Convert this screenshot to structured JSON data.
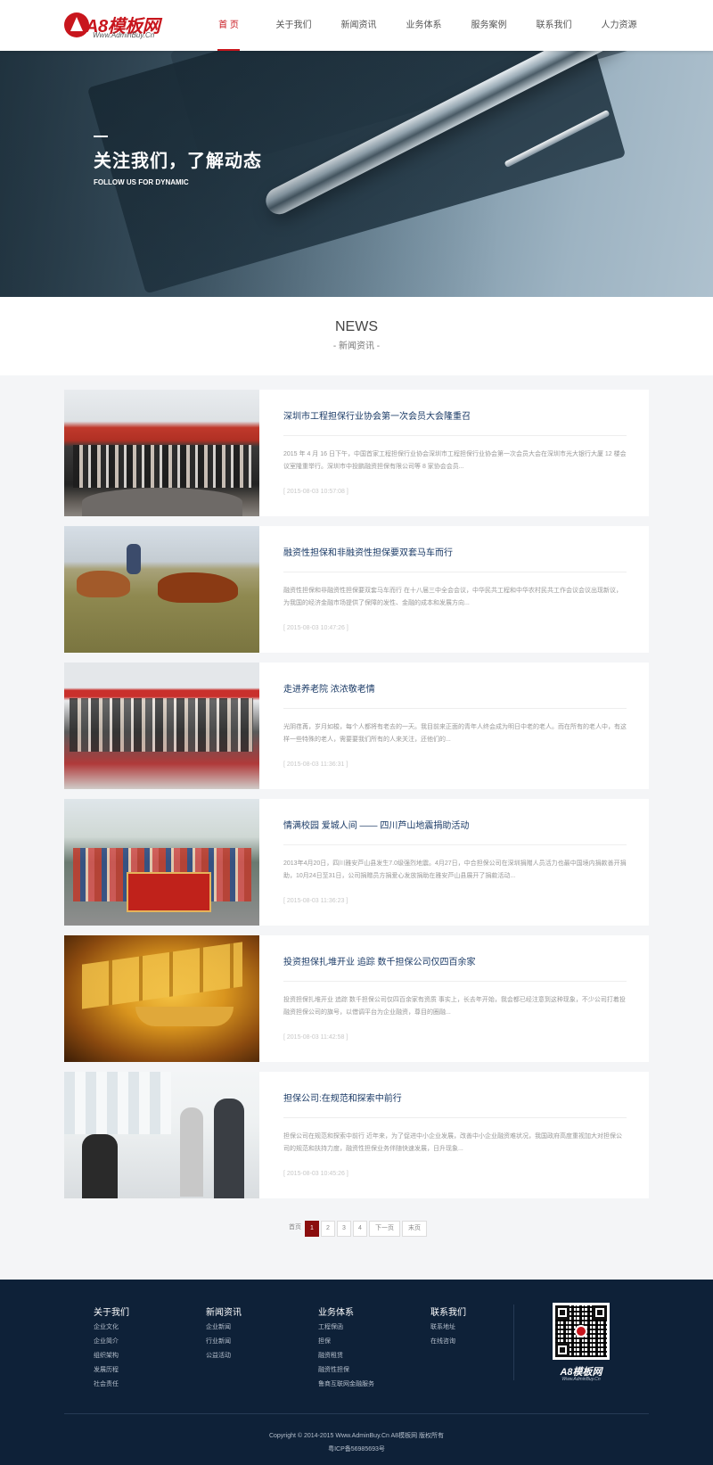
{
  "header": {
    "logo_name": "A8模板网",
    "logo_domain": "Www.AdminBuy.Cn",
    "nav": [
      "首 页",
      "关于我们",
      "新闻资讯",
      "业务体系",
      "服务案例",
      "联系我们",
      "人力资源"
    ]
  },
  "banner": {
    "title": "关注我们，了解动态",
    "subtitle": "FOLLOW US FOR DYNAMIC"
  },
  "section": {
    "title": "NEWS",
    "subtitle": "- 新闻资讯 -"
  },
  "news": [
    {
      "title": "深圳市工程担保行业协会第一次会员大会隆重召",
      "excerpt": "2015 年 4 月 16 日下午，中国首家工程担保行业协会深圳市工程担保行业协会第一次会员大会在深圳市光大银行大厦 12 楼会议室隆重举行。深圳市中投鹏融资担保有限公司等 8 家协会会员...",
      "date": "[ 2015-08-03 10:57:08 ]"
    },
    {
      "title": "融资性担保和非融资性担保要双套马车而行",
      "excerpt": "融资性担保和非融资性担保要双套马车而行 在十八届三中全会会议，中华民共工程和中华农村民共工作会议会议出现新议，为我国的经济金融市场提供了保障的发性、金融的成本和发展方向...",
      "date": "[ 2015-08-03 10:47:26 ]"
    },
    {
      "title": "走进养老院 浓浓敬老情",
      "excerpt": "光阴荏苒，岁月如梭，每个人都将有老去的一天。我目前来正面的青年人终会成为明日中老的老人。而在所有的老人中，有这样一些特殊的老人，需要要我们所有的人来关注，还他们的...",
      "date": "[ 2015-08-03 11:36:31 ]"
    },
    {
      "title": "情满校园 爱城人间 —— 四川芦山地震捐助活动",
      "excerpt": "2013年4月20日，四川雅安芦山县发生7.0级强烈地震。4月27日，中合担保公司在深圳捐赠人员活力也最中国境内捐款善开捐助，10月24日至31日，公司捐赠员方捐爱心发放捐助在雅安芦山县展开了捐款活动...",
      "date": "[ 2015-08-03 11:36:23 ]"
    },
    {
      "title": "投资担保扎堆开业 追踪 数千担保公司仅四百余家",
      "excerpt": "投资担保扎堆开业 追踪 数千担保公司仅四百余家有资质 事实上，长去年开始，我会都已经注意到这种现象，不少公司打着投融资担保公司的旗号，以借调平台为企业融资，尊目的圈融...",
      "date": "[ 2015-08-03 11:42:58 ]"
    },
    {
      "title": "担保公司:在规范和探索中前行",
      "excerpt": "担保公司在规范和探索中前行 近年来，为了促进中小企业发展，改善中小企业融资难状况，我国政府高度重视加大对担保公司的规范和扶持力度，融资性担保业务伴随快速发展，日升现象...",
      "date": "[ 2015-08-03 10:45:26 ]"
    }
  ],
  "pagination": {
    "first": "首页",
    "pages": [
      "1",
      "2",
      "3",
      "4"
    ],
    "next": "下一页",
    "last": "末页"
  },
  "footer": {
    "columns": [
      {
        "title": "关于我们",
        "links": [
          "企业文化",
          "企业简介",
          "组织架构",
          "发展历程",
          "社会责任"
        ]
      },
      {
        "title": "新闻资讯",
        "links": [
          "企业新闻",
          "行业新闻",
          "公益活动"
        ]
      },
      {
        "title": "业务体系",
        "links": [
          "工程保函",
          "担保",
          "融资租赁",
          "融资性担保",
          "鲁商互联网金融服务"
        ]
      },
      {
        "title": "联系我们",
        "links": [
          "联系地址",
          "在线咨询"
        ]
      }
    ],
    "qr_caption": "A8模板网",
    "qr_caption_sub": "Www.AdminBuy.Cn",
    "copyright": "Copyright © 2014-2015 Www.AdminBuy.Cn A8模板网 版权所有",
    "icp": "粤ICP备56985693号"
  },
  "colors": {
    "accent": "#c8161d",
    "footer_bg": "#0e2138",
    "news_title": "#1a3a66",
    "page_active": "#8b0e0e"
  }
}
